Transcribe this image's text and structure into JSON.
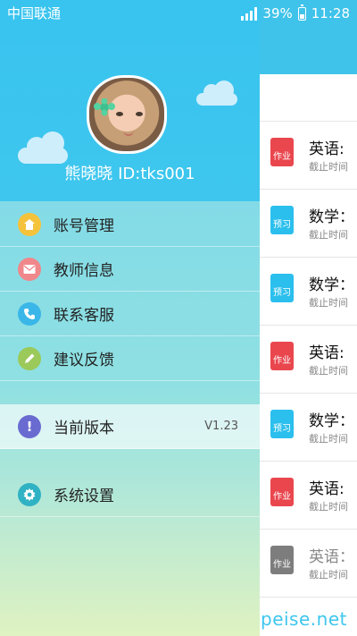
{
  "status_bar": {
    "carrier": "中国联通",
    "battery": "39%",
    "time": "11:28"
  },
  "profile": {
    "name": "熊晓晓 ID:tks001"
  },
  "menu": {
    "items": [
      {
        "label": "账号管理",
        "icon": "home-icon",
        "color": "#f5c33b"
      },
      {
        "label": "教师信息",
        "icon": "mail-icon",
        "color": "#f0878b"
      },
      {
        "label": "联系客服",
        "icon": "phone-icon",
        "color": "#3ab7e8"
      },
      {
        "label": "建议反馈",
        "icon": "pencil-icon",
        "color": "#9bc95a"
      }
    ],
    "version": {
      "label": "当前版本",
      "value": "V1.23",
      "icon": "info-icon",
      "color": "#6a6bd0"
    },
    "settings": {
      "label": "系统设置",
      "icon": "gear-icon",
      "color": "#2fb2c3"
    }
  },
  "tasks": [
    {
      "type": "作业",
      "title": "英语:",
      "sub": "截止时间",
      "color": "#e9464e"
    },
    {
      "type": "预习",
      "title": "数学：",
      "sub": "截止时间",
      "color": "#2bbfed"
    },
    {
      "type": "预习",
      "title": "数学：",
      "sub": "截止时间",
      "color": "#2bbfed"
    },
    {
      "type": "作业",
      "title": "英语:",
      "sub": "截止时间",
      "color": "#e9464e"
    },
    {
      "type": "预习",
      "title": "数学：",
      "sub": "截止时间",
      "color": "#2bbfed"
    },
    {
      "type": "作业",
      "title": "英语:",
      "sub": "截止时间",
      "color": "#e9464e"
    },
    {
      "type": "作业",
      "title": "英语：",
      "sub": "截止时间",
      "color": "#7d7d7d"
    }
  ],
  "watermark": "peise.net"
}
